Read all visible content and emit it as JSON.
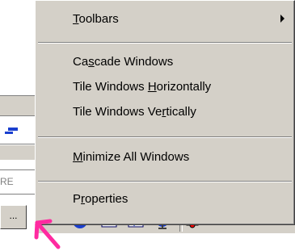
{
  "context_menu": {
    "items": [
      {
        "id": "toolbars",
        "label": "Toolbars",
        "accel_index": 0,
        "has_submenu": true
      },
      {
        "id": "cascade",
        "label": "Cascade Windows",
        "accel_index": 2,
        "has_submenu": false
      },
      {
        "id": "tile_h",
        "label": "Tile Windows Horizontally",
        "accel_index": 13,
        "has_submenu": false
      },
      {
        "id": "tile_v",
        "label": "Tile Windows Vertically",
        "accel_index": 15,
        "has_submenu": false
      },
      {
        "id": "minimize",
        "label": "Minimize All Windows",
        "accel_index": 0,
        "has_submenu": false
      },
      {
        "id": "properties",
        "label": "Properties",
        "accel_index": 1,
        "has_submenu": false
      }
    ]
  },
  "background": {
    "fragment_text": "RE",
    "ellipsis_label": "..."
  },
  "taskbar": {
    "tray_icons": [
      "internet-explorer-icon",
      "outlook-icon",
      "check-document-icon",
      "channels-icon",
      "media-icon"
    ]
  },
  "colors": {
    "face": "#d4d0c8",
    "shadow": "#808080",
    "highlight": "#ffffff",
    "accent": "#ff2aa0"
  }
}
